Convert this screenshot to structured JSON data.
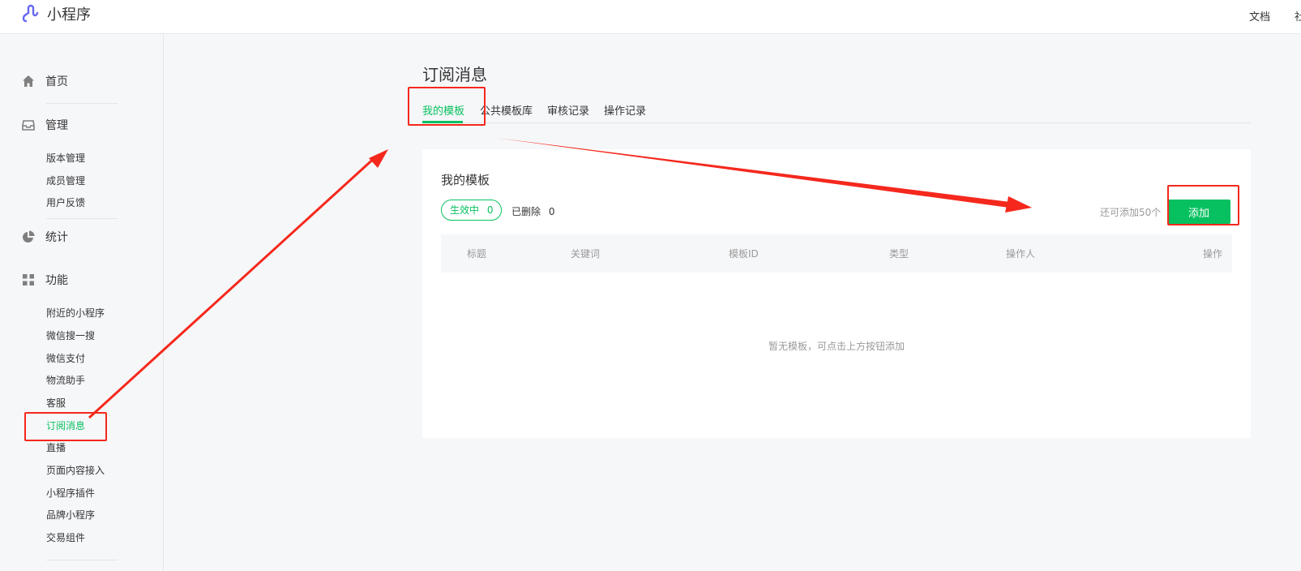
{
  "app": {
    "title": "小程序",
    "top_links": [
      "文档",
      "社"
    ]
  },
  "sidebar": {
    "home": "首页",
    "manage": {
      "label": "管理",
      "items": [
        "版本管理",
        "成员管理",
        "用户反馈"
      ]
    },
    "stats": "统计",
    "features": {
      "label": "功能",
      "items": [
        "附近的小程序",
        "微信搜一搜",
        "微信支付",
        "物流助手",
        "客服",
        "订阅消息",
        "直播",
        "页面内容接入",
        "小程序插件",
        "品牌小程序",
        "交易组件"
      ],
      "active": "订阅消息"
    }
  },
  "main": {
    "title": "订阅消息",
    "tabs": [
      "我的模板",
      "公共模板库",
      "审核记录",
      "操作记录"
    ],
    "card": {
      "title": "我的模板",
      "status_active": "生效中",
      "active_count": "0",
      "status_deleted": "已删除",
      "deleted_count": "0",
      "remaining": "还可添加50个",
      "add_button": "添加",
      "columns": [
        "标题",
        "关键词",
        "模板ID",
        "类型",
        "操作人",
        "操作"
      ],
      "empty_message": "暂无模板，可点击上方按钮添加"
    }
  },
  "colors": {
    "accent": "#07c160",
    "annotation": "#f5281d",
    "logo": "#6467f0"
  }
}
